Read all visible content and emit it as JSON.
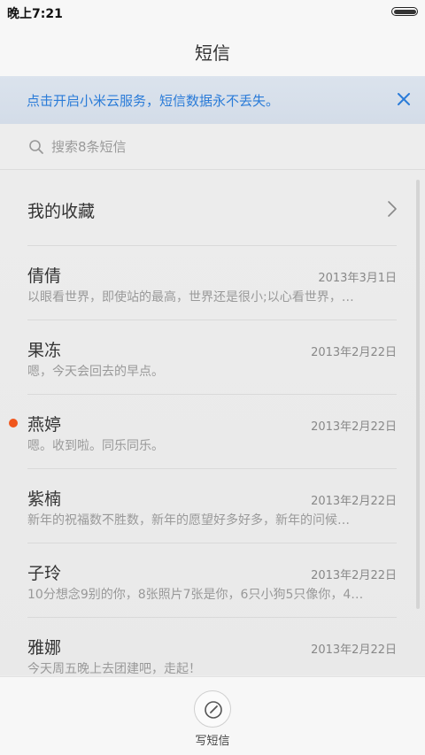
{
  "status_bar": {
    "time": "晚上7:21",
    "battery_level": 1.0
  },
  "header": {
    "title": "短信"
  },
  "banner": {
    "text": "点击开启小米云服务，短信数据永不丢失。",
    "close_icon": "close-icon",
    "color": "#2a7bd8"
  },
  "search": {
    "placeholder": "搜索8条短信",
    "icon": "search-icon"
  },
  "favorites": {
    "label": "我的收藏",
    "icon": "chevron-right-icon"
  },
  "conversations": [
    {
      "name": "倩倩",
      "date": "2013年3月1日",
      "preview": "以眼看世界，即使站的最高，世界还是很小;以心看世界，…",
      "unread": false
    },
    {
      "name": "果冻",
      "date": "2013年2月22日",
      "preview": "嗯，今天会回去的早点。",
      "unread": false
    },
    {
      "name": "燕婷",
      "date": "2013年2月22日",
      "preview": "嗯。收到啦。同乐同乐。",
      "unread": true
    },
    {
      "name": "紫楠",
      "date": "2013年2月22日",
      "preview": "新年的祝福数不胜数，新年的愿望好多好多，新年的问候…",
      "unread": false
    },
    {
      "name": "子玲",
      "date": "2013年2月22日",
      "preview": "10分想念9别的你，8张照片7张是你，6只小狗5只像你，4…",
      "unread": false
    },
    {
      "name": "雅娜",
      "date": "2013年2月22日",
      "preview": "今天周五晚上去团建吧，走起！",
      "unread": false
    }
  ],
  "bottom_bar": {
    "compose_label": "写短信",
    "compose_icon": "compose-icon"
  },
  "colors": {
    "unread_dot": "#f0561c",
    "text_primary": "#333333",
    "text_secondary": "#999999"
  }
}
